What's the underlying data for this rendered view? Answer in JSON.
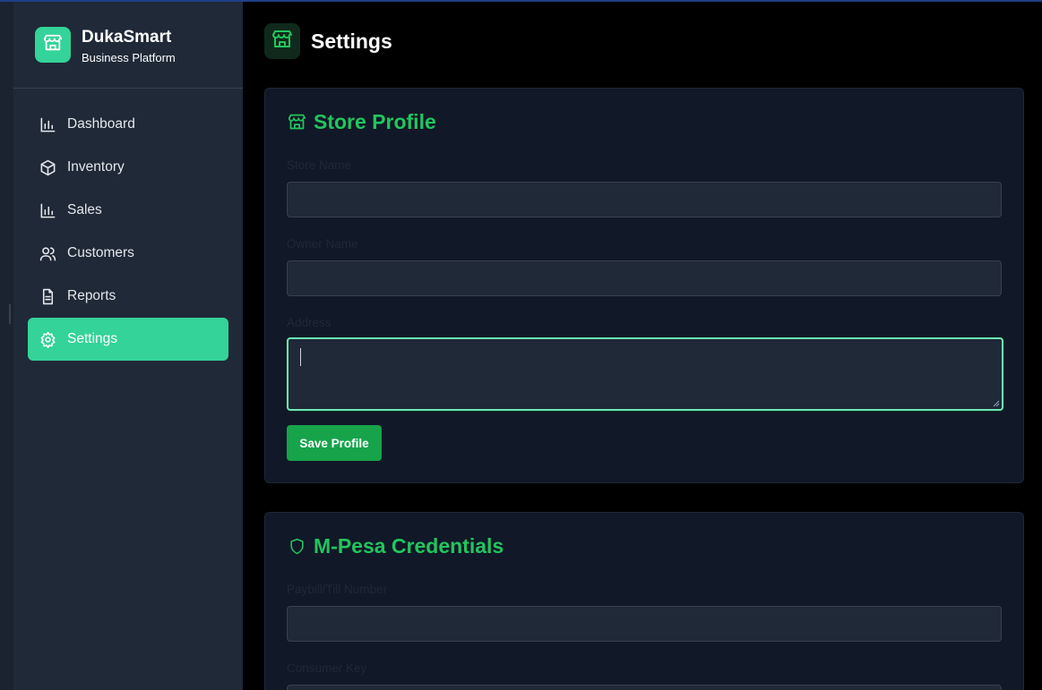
{
  "brand": {
    "name": "DukaSmart",
    "subtitle": "Business Platform",
    "icon": "store-icon"
  },
  "sidebar": {
    "items": [
      {
        "label": "Dashboard",
        "icon": "bar-chart-icon",
        "active": false
      },
      {
        "label": "Inventory",
        "icon": "package-icon",
        "active": false
      },
      {
        "label": "Sales",
        "icon": "bar-chart-icon",
        "active": false
      },
      {
        "label": "Customers",
        "icon": "users-icon",
        "active": false
      },
      {
        "label": "Reports",
        "icon": "file-text-icon",
        "active": false
      },
      {
        "label": "Settings",
        "icon": "gear-icon",
        "active": true
      }
    ]
  },
  "page": {
    "title": "Settings",
    "icon": "store-icon"
  },
  "store_profile": {
    "title": "Store Profile",
    "icon": "store-icon",
    "store_name_label": "Store Name",
    "store_name_value": "",
    "owner_name_label": "Owner Name",
    "owner_name_value": "",
    "address_label": "Address",
    "address_value": "",
    "save_label": "Save Profile"
  },
  "mpesa": {
    "title": "M-Pesa Credentials",
    "icon": "shield-icon",
    "paybill_label": "Paybill/Till Number",
    "paybill_value": "",
    "consumer_key_label": "Consumer Key",
    "consumer_key_value": ""
  },
  "colors": {
    "accent": "#34d399",
    "accent_dark": "#16a34a",
    "heading_green": "#22c55e",
    "sidebar_bg": "#1f2937",
    "card_bg": "#111827"
  }
}
